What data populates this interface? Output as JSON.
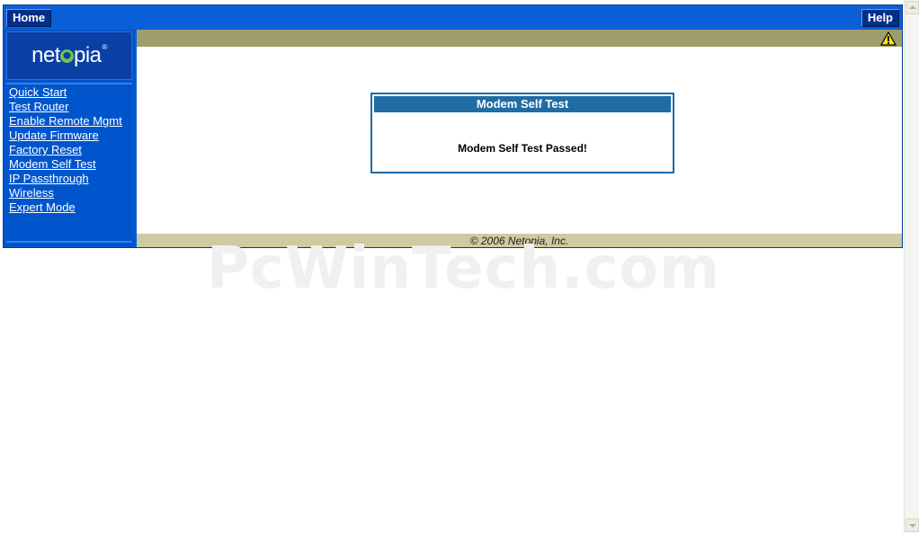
{
  "topbar": {
    "home_label": "Home",
    "help_label": "Help"
  },
  "sidebar": {
    "logo_text_left": "net",
    "logo_text_right": "pia",
    "logo_mark": "®",
    "items": [
      {
        "label": "Quick Start"
      },
      {
        "label": "Test Router"
      },
      {
        "label": "Enable Remote Mgmt"
      },
      {
        "label": "Update Firmware"
      },
      {
        "label": "Factory Reset"
      },
      {
        "label": "Modem Self Test"
      },
      {
        "label": "IP Passthrough"
      },
      {
        "label": "Wireless"
      },
      {
        "label": "Expert Mode"
      }
    ]
  },
  "content": {
    "warning_icon": "warning-triangle-icon",
    "panel_title": "Modem Self Test",
    "panel_message": "Modem Self Test Passed!",
    "footer": "© 2006 Netopia, Inc."
  },
  "watermark": "PcWinTech.com",
  "colors": {
    "nav_blue": "#0055cc",
    "panel_title_blue": "#1f6da4",
    "header_olive": "#a09d6c",
    "footer_tan": "#cdcba1"
  }
}
